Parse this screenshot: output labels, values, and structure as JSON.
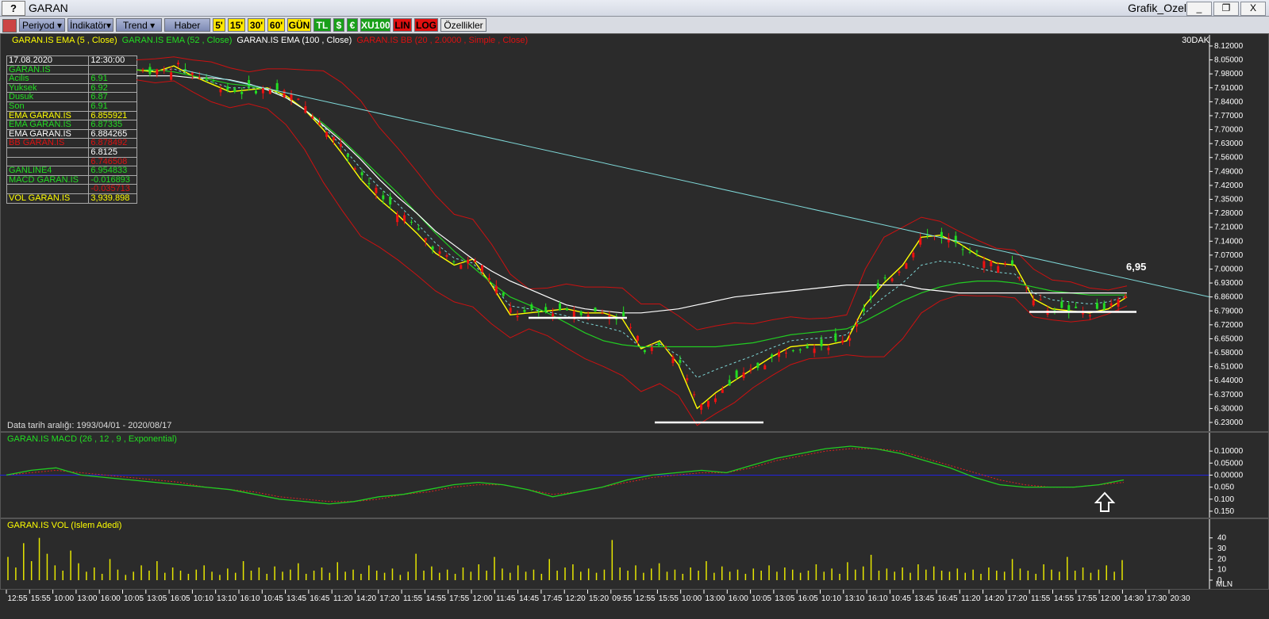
{
  "window": {
    "title_short": "?",
    "title": "GARAN",
    "right_title": "Grafik_Ozel",
    "minimize": "_",
    "restore": "❐",
    "close": "X"
  },
  "toolbar": {
    "buttons": [
      {
        "label": "Periyod ▾",
        "style": "blue"
      },
      {
        "label": "İndikatör▾",
        "style": "blue"
      },
      {
        "label": "Trend ▾",
        "style": "blue"
      },
      {
        "label": "Haber",
        "style": "blue"
      },
      {
        "label": "5'",
        "style": "yellow"
      },
      {
        "label": "15'",
        "style": "yellow"
      },
      {
        "label": "30'",
        "style": "yellow"
      },
      {
        "label": "60'",
        "style": "yellow"
      },
      {
        "label": "GÜN",
        "style": "yellow"
      },
      {
        "label": "TL",
        "style": "green"
      },
      {
        "label": "$",
        "style": "green"
      },
      {
        "label": "€",
        "style": "green"
      },
      {
        "label": "XU100",
        "style": "green"
      },
      {
        "label": "LIN",
        "style": "red"
      },
      {
        "label": "LOG",
        "style": "red"
      },
      {
        "label": "Özellikler",
        "style": "grey"
      }
    ]
  },
  "price_panel": {
    "legend": [
      {
        "text": "GARAN.IS EMA (5 , Close)",
        "color": "#ffff00"
      },
      {
        "text": "GARAN.IS EMA (52 , Close)",
        "color": "#22dd22"
      },
      {
        "text": "GARAN.IS EMA (100 , Close)",
        "color": "#ffffff"
      },
      {
        "text": "GARAN.IS BB (20 , 2.0000 , Simple , Close)",
        "color": "#dd1111"
      }
    ],
    "period": "30DAK",
    "date_range": "Data tarih aralığı: 1993/04/01 - 2020/08/17",
    "annotation": "6,95",
    "info": [
      {
        "label": "17.08.2020",
        "value": "12:30:00",
        "lc": "#ffffff",
        "vc": "#ffffff"
      },
      {
        "label": "GARAN.IS",
        "value": "",
        "lc": "#22dd22",
        "vc": "#ffffff"
      },
      {
        "label": " Acilis",
        "value": "6.91",
        "lc": "#22dd22",
        "vc": "#22dd22"
      },
      {
        "label": " Yuksek",
        "value": "6.92",
        "lc": "#22dd22",
        "vc": "#22dd22"
      },
      {
        "label": " Dusuk",
        "value": "6.87",
        "lc": "#22dd22",
        "vc": "#22dd22"
      },
      {
        "label": " Son",
        "value": "6.91",
        "lc": "#22dd22",
        "vc": "#22dd22"
      },
      {
        "label": "EMA GARAN.IS",
        "value": "6.855921",
        "lc": "#ffff00",
        "vc": "#ffff00"
      },
      {
        "label": "EMA GARAN.IS",
        "value": "6.87335",
        "lc": "#22dd22",
        "vc": "#22dd22"
      },
      {
        "label": "EMA GARAN.IS",
        "value": "6.884265",
        "lc": "#ffffff",
        "vc": "#ffffff"
      },
      {
        "label": "BB GARAN.IS",
        "value": "6.878492",
        "lc": "#dd1111",
        "vc": "#dd1111"
      },
      {
        "label": "",
        "value": "6.8125",
        "lc": "#ffffff",
        "vc": "#ffffff"
      },
      {
        "label": "",
        "value": "6.746508",
        "lc": "#dd1111",
        "vc": "#dd1111"
      },
      {
        "label": "GANLINE4",
        "value": "6.954833",
        "lc": "#22dd22",
        "vc": "#22dd22"
      },
      {
        "label": "MACD GARAN.IS",
        "value": "-0.016893",
        "lc": "#22dd22",
        "vc": "#22dd22"
      },
      {
        "label": "",
        "value": "-0.035713",
        "lc": "#dd1111",
        "vc": "#dd1111"
      },
      {
        "label": "VOL GARAN.IS",
        "value": "3,939.898",
        "lc": "#ffff00",
        "vc": "#ffff00"
      }
    ]
  },
  "macd_panel": {
    "legend": "GARAN.IS MACD (26 , 12 , 9 , Exponential)"
  },
  "vol_panel": {
    "legend": "GARAN.IS VOL (Islem Adedi)",
    "unit": "MLN"
  },
  "colors": {
    "up": "#22dd22",
    "down": "#ee1111",
    "ema5": "#ffff00",
    "ema52": "#22cc22",
    "ema100": "#ffffff",
    "bb": "#cc1111",
    "trend": "#7fd8d8",
    "macd": "#22cc22",
    "signal": "#dd2222",
    "zero": "#2222dd",
    "vol": "#e6e600"
  },
  "chart_data": [
    {
      "type": "line",
      "title": "GARAN",
      "ylim": [
        6.2,
        8.13
      ],
      "y_ticks": [
        "8.12000",
        "8.05000",
        "7.98000",
        "7.91000",
        "7.84000",
        "7.77000",
        "7.70000",
        "7.63000",
        "7.56000",
        "7.49000",
        "7.42000",
        "7.35000",
        "7.28000",
        "7.21000",
        "7.14000",
        "7.07000",
        "7.00000",
        "6.93000",
        "6.86000",
        "6.79000",
        "6.72000",
        "6.65000",
        "6.58000",
        "6.51000",
        "6.44000",
        "6.37000",
        "6.30000",
        "6.23000"
      ],
      "x_ticks": [
        "12:55",
        "15:55",
        "10:00",
        "13:00",
        "16:00",
        "10:05",
        "13:05",
        "16:05",
        "10:10",
        "13:10",
        "16:10",
        "10:45",
        "13:45",
        "16:45",
        "11:20",
        "14:20",
        "17:20",
        "11:55",
        "14:55",
        "17:55",
        "12:00",
        "11:45",
        "14:45",
        "17:45",
        "12:20",
        "15:20",
        "09:55",
        "12:55",
        "15:55",
        "10:00",
        "13:00",
        "16:00",
        "10:05",
        "13:05",
        "16:05",
        "10:10",
        "13:10",
        "16:10",
        "10:45",
        "13:45",
        "16:45",
        "11:20",
        "14:20",
        "17:20",
        "11:55",
        "14:55",
        "17:55",
        "12:00",
        "14:30",
        "17:30",
        "20:30"
      ],
      "series": [
        {
          "name": "GARAN.IS EMA (5 , Close)",
          "values": [
            8.0,
            7.99,
            8.02,
            7.97,
            7.93,
            7.89,
            7.9,
            7.91,
            7.87,
            7.8,
            7.7,
            7.58,
            7.45,
            7.35,
            7.27,
            7.18,
            7.08,
            7.02,
            7.05,
            6.92,
            6.77,
            6.78,
            6.79,
            6.8,
            6.78,
            6.78,
            6.75,
            6.6,
            6.64,
            6.52,
            6.3,
            6.38,
            6.44,
            6.5,
            6.56,
            6.61,
            6.62,
            6.62,
            6.64,
            6.82,
            6.93,
            7.02,
            7.16,
            7.17,
            7.13,
            7.07,
            7.03,
            7.02,
            6.85,
            6.8,
            6.79,
            6.78,
            6.8,
            6.86
          ]
        },
        {
          "name": "GARAN.IS EMA (52 , Close)",
          "values": [
            8.0,
            8.0,
            7.99,
            7.97,
            7.95,
            7.93,
            7.92,
            7.9,
            7.86,
            7.8,
            7.73,
            7.65,
            7.56,
            7.47,
            7.38,
            7.28,
            7.18,
            7.09,
            7.01,
            6.93,
            6.86,
            6.82,
            6.78,
            6.73,
            6.68,
            6.64,
            6.62,
            6.61,
            6.61,
            6.61,
            6.61,
            6.61,
            6.62,
            6.63,
            6.65,
            6.67,
            6.68,
            6.69,
            6.7,
            6.74,
            6.79,
            6.84,
            6.88,
            6.91,
            6.93,
            6.94,
            6.94,
            6.93,
            6.91,
            6.89,
            6.88,
            6.87,
            6.87,
            6.87
          ]
        },
        {
          "name": "GARAN.IS EMA (100 , Close)",
          "values": [
            7.97,
            7.97,
            7.97,
            7.96,
            7.96,
            7.95,
            7.93,
            7.9,
            7.86,
            7.8,
            7.72,
            7.64,
            7.55,
            7.45,
            7.36,
            7.28,
            7.19,
            7.12,
            7.05,
            6.99,
            6.94,
            6.9,
            6.86,
            6.82,
            6.8,
            6.79,
            6.78,
            6.78,
            6.79,
            6.8,
            6.82,
            6.84,
            6.86,
            6.87,
            6.88,
            6.89,
            6.9,
            6.91,
            6.92,
            6.92,
            6.92,
            6.92,
            6.9,
            6.89,
            6.88,
            6.88,
            6.88,
            6.88,
            6.88,
            6.88,
            6.88,
            6.88,
            6.88,
            6.88
          ]
        }
      ]
    },
    {
      "type": "line",
      "title": "GARAN.IS MACD (26 , 12 , 9 , Exponential)",
      "ylim": [
        -0.16,
        0.13
      ],
      "y_ticks": [
        "0.10000",
        "0.05000",
        "0.00000",
        "0.050",
        "0.100",
        "0.150"
      ],
      "series": [
        {
          "name": "MACD",
          "values": [
            0.0,
            0.02,
            0.03,
            0.0,
            -0.01,
            -0.02,
            -0.03,
            -0.04,
            -0.05,
            -0.06,
            -0.08,
            -0.1,
            -0.11,
            -0.12,
            -0.11,
            -0.09,
            -0.08,
            -0.06,
            -0.04,
            -0.03,
            -0.04,
            -0.06,
            -0.09,
            -0.07,
            -0.05,
            -0.02,
            0.0,
            0.01,
            0.02,
            0.01,
            0.04,
            0.07,
            0.09,
            0.11,
            0.12,
            0.11,
            0.09,
            0.06,
            0.03,
            -0.01,
            -0.04,
            -0.05,
            -0.05,
            -0.05,
            -0.04,
            -0.02
          ]
        },
        {
          "name": "Signal",
          "values": [
            0.0,
            0.01,
            0.02,
            0.01,
            0.0,
            -0.01,
            -0.02,
            -0.03,
            -0.05,
            -0.06,
            -0.07,
            -0.09,
            -0.1,
            -0.11,
            -0.11,
            -0.1,
            -0.08,
            -0.07,
            -0.05,
            -0.04,
            -0.04,
            -0.06,
            -0.08,
            -0.07,
            -0.05,
            -0.03,
            -0.01,
            0.0,
            0.01,
            0.01,
            0.03,
            0.06,
            0.08,
            0.1,
            0.11,
            0.11,
            0.1,
            0.07,
            0.04,
            0.01,
            -0.02,
            -0.04,
            -0.05,
            -0.05,
            -0.04,
            -0.03
          ]
        }
      ]
    },
    {
      "type": "bar",
      "title": "GARAN.IS VOL (Islem Adedi)",
      "ylabel": "MLN",
      "ylim": [
        0,
        45
      ],
      "y_ticks": [
        "40",
        "30",
        "20",
        "10",
        "0"
      ],
      "values": [
        22,
        12,
        35,
        18,
        40,
        25,
        14,
        9,
        28,
        16,
        8,
        12,
        6,
        20,
        10,
        5,
        8,
        14,
        9,
        18,
        7,
        12,
        9,
        6,
        10,
        14,
        8,
        5,
        11,
        7,
        18,
        9,
        12,
        6,
        13,
        8,
        10,
        16,
        6,
        9,
        12,
        7,
        17,
        8,
        10,
        6,
        14,
        9,
        7,
        11,
        5,
        8,
        25,
        9,
        13,
        7,
        10,
        6,
        12,
        8,
        15,
        9,
        22,
        11,
        7,
        14,
        8,
        10,
        6,
        20,
        9,
        12,
        15,
        8,
        11,
        7,
        10,
        38,
        12,
        9,
        14,
        7,
        11,
        16,
        8,
        10,
        6,
        12,
        9,
        18,
        7,
        13,
        8,
        10,
        6,
        11,
        9,
        14,
        8,
        12,
        10,
        7,
        9,
        15,
        8,
        11,
        6,
        17,
        10,
        13,
        24,
        9,
        11,
        8,
        12,
        7,
        15,
        10,
        13,
        9,
        8,
        11,
        7,
        10,
        6,
        12,
        9,
        8,
        20,
        11,
        9,
        6,
        15,
        10,
        8,
        22,
        9,
        12,
        7,
        10,
        14,
        8,
        19
      ]
    }
  ]
}
